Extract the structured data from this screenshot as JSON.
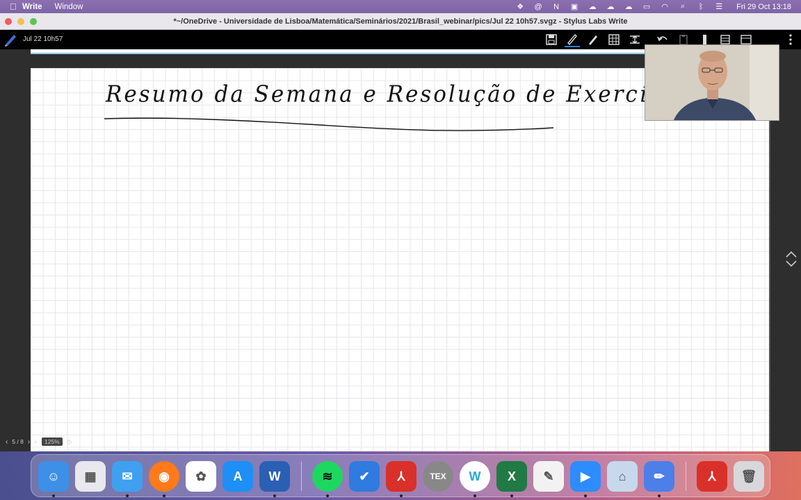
{
  "menubar": {
    "app_name": "Write",
    "menus": [
      "Window"
    ],
    "clock": "Fri 29 Oct  13:18"
  },
  "window": {
    "title": "*~/OneDrive - Universidade de Lisboa/Matemática/Seminários/2021/Brasil_webinar/pics/Jul 22 10h57.svgz - Stylus Labs Write"
  },
  "toolbar": {
    "doc_title": "Jul 22 10h57",
    "icons": [
      "save-icon",
      "pen-icon",
      "highlighter-icon",
      "grid-select-icon",
      "insert-space-icon",
      "undo-icon",
      "clipboard-icon",
      "ruler-icon",
      "stack-icon",
      "layout-icon",
      "more-icon"
    ]
  },
  "page": {
    "handwritten_title": "Resumo da Semana e Resolução de Exercícios"
  },
  "status": {
    "page_indicator": "5 / 8",
    "zoom": "125%"
  },
  "dock": {
    "apps": [
      {
        "name": "Finder",
        "color": "#3d8fe8",
        "glyph": "☺"
      },
      {
        "name": "Launchpad",
        "color": "#e8e8ee",
        "glyph": "▦"
      },
      {
        "name": "Mail",
        "color": "#3fa0f0",
        "glyph": "✉"
      },
      {
        "name": "Firefox",
        "color": "#ff7a1a",
        "glyph": "◉"
      },
      {
        "name": "Photos",
        "color": "#ffffff",
        "glyph": "✿"
      },
      {
        "name": "App Store",
        "color": "#1e8ff5",
        "glyph": "A"
      },
      {
        "name": "Microsoft Word",
        "color": "#2b5fb4",
        "glyph": "W"
      },
      {
        "name": "Spotify",
        "color": "#1ed760",
        "glyph": "≋"
      },
      {
        "name": "Tasks",
        "color": "#2f7be0",
        "glyph": "✔"
      },
      {
        "name": "Acrobat",
        "color": "#d9302a",
        "glyph": "⅄"
      },
      {
        "name": "TeX",
        "color": "#888888",
        "glyph": "TEX"
      },
      {
        "name": "Write",
        "color": "#ffffff",
        "glyph": "W"
      },
      {
        "name": "Excel",
        "color": "#1f7a44",
        "glyph": "X"
      },
      {
        "name": "Scripts",
        "color": "#f2f2f2",
        "glyph": "✎"
      },
      {
        "name": "Zoom",
        "color": "#2d8cff",
        "glyph": "▶"
      },
      {
        "name": "Preview",
        "color": "#c8d8ec",
        "glyph": "⌂"
      },
      {
        "name": "Stylus Pen",
        "color": "#4c7fe8",
        "glyph": "✏"
      },
      {
        "name": "Acrobat Reader",
        "color": "#d9302a",
        "glyph": "⅄"
      },
      {
        "name": "Trash",
        "color": "#d8d8dc",
        "glyph": "🗑"
      }
    ]
  }
}
